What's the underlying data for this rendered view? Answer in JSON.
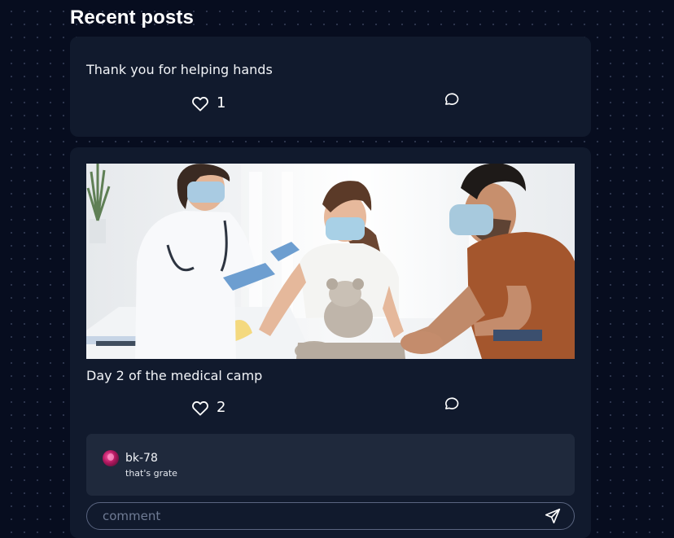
{
  "section": {
    "title": "Recent posts"
  },
  "posts": [
    {
      "text": "Thank you for helping hands",
      "likes": "1",
      "has_image": false
    },
    {
      "text": "Day 2 of the medical camp",
      "likes": "2",
      "has_image": true,
      "comments": [
        {
          "user": "bk-78",
          "text": "that's grate"
        }
      ],
      "comment_input_placeholder": "comment"
    }
  ],
  "icons": {
    "like": "heart-icon",
    "comment": "comment-icon",
    "send": "send-icon"
  },
  "colors": {
    "background": "#070d1f",
    "card": "#111a2d",
    "comment_box": "#1f293c",
    "text": "#ffffff"
  }
}
